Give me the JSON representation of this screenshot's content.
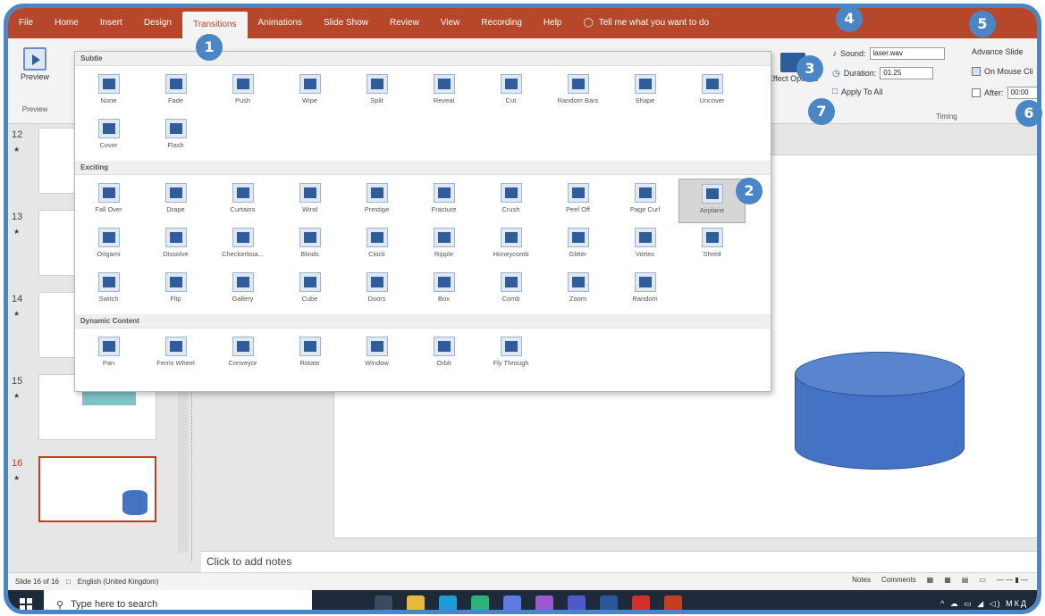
{
  "ribbon": {
    "tabs": [
      "File",
      "Home",
      "Insert",
      "Design",
      "Transitions",
      "Animations",
      "Slide Show",
      "Review",
      "View",
      "Recording",
      "Help"
    ],
    "active_tab": "Transitions",
    "tell_me": "Tell me what you want to do",
    "tell_me_icon": "lightbulb-icon"
  },
  "preview": {
    "label": "Preview",
    "group": "Preview",
    "icon": "preview-icon"
  },
  "effect_options": {
    "label": "Effect Options",
    "icon": "airplane-icon"
  },
  "timing": {
    "sound_label": "Sound:",
    "sound_value": "laser.wav",
    "duration_label": "Duration:",
    "duration_value": "01.25",
    "apply_all": "Apply To All",
    "advance_label": "Advance Slide",
    "on_mouse_click": "On Mouse Cli",
    "after_label": "After:",
    "after_value": "00:00",
    "group": "Timing"
  },
  "gallery": {
    "sections": [
      {
        "title": "Subtle",
        "items": [
          "None",
          "Fade",
          "Push",
          "Wipe",
          "Split",
          "Reveal",
          "Cut",
          "Random Bars",
          "Shape",
          "Uncover",
          "Cover",
          "Flash"
        ]
      },
      {
        "title": "Exciting",
        "items": [
          "Fall Over",
          "Drape",
          "Curtains",
          "Wind",
          "Prestige",
          "Fracture",
          "Crush",
          "Peel Off",
          "Page Curl",
          "Airplane",
          "Origami",
          "Dissolve",
          "Checkerboa...",
          "Blinds",
          "Clock",
          "Ripple",
          "Honeycomb",
          "Glitter",
          "Vortex",
          "Shred",
          "Switch",
          "Flip",
          "Gallery",
          "Cube",
          "Doors",
          "Box",
          "Comb",
          "Zoom",
          "Random"
        ]
      },
      {
        "title": "Dynamic Content",
        "items": [
          "Pan",
          "Ferris Wheel",
          "Conveyor",
          "Rotate",
          "Window",
          "Orbit",
          "Fly Through"
        ]
      }
    ],
    "selected": "Airplane"
  },
  "slides": {
    "numbers": [
      "12",
      "13",
      "14",
      "15",
      "16"
    ],
    "active": "16"
  },
  "notes_placeholder": "Click to add notes",
  "status": {
    "slide_info": "Slide 16 of 16",
    "language": "English (United Kingdom)",
    "notes": "Notes",
    "comments": "Comments"
  },
  "taskbar": {
    "search_placeholder": "Type here to search",
    "tray": "МКД"
  },
  "badges": [
    "1",
    "2",
    "3",
    "4",
    "5",
    "6",
    "7"
  ],
  "colors": {
    "accent": "#b7472a",
    "badge": "#4a86c6",
    "shape": "#4472c4"
  }
}
